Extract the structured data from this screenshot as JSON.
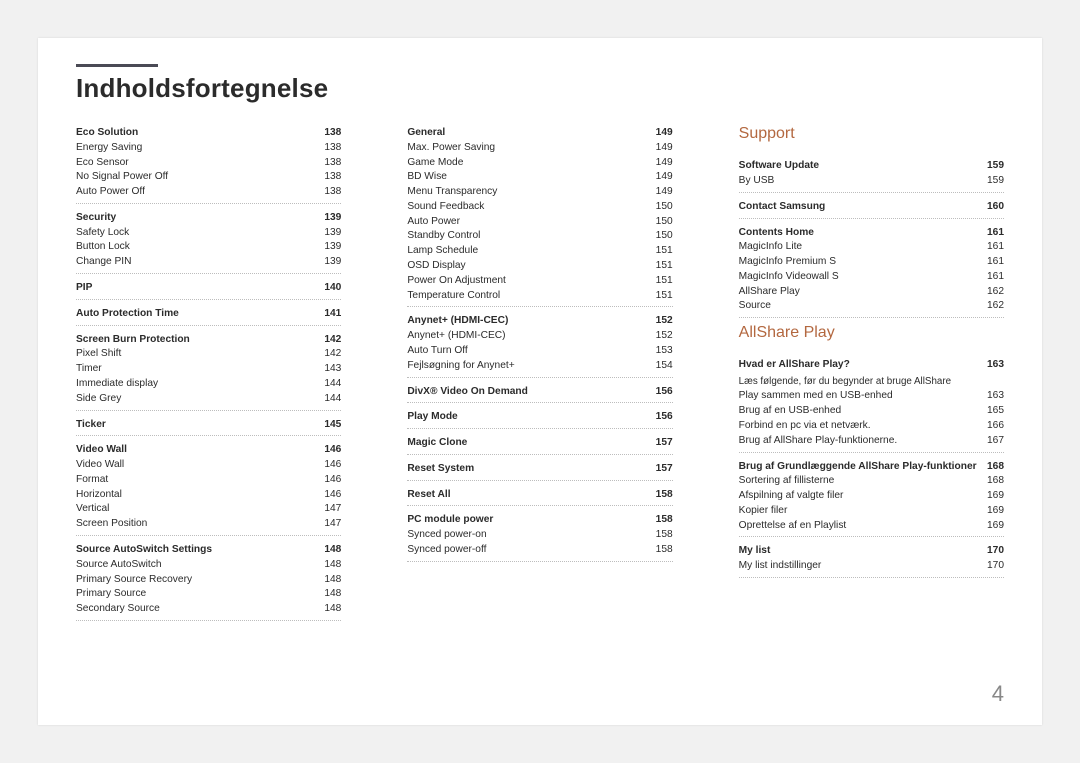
{
  "title": "Indholdsfortegnelse",
  "page_number": "4",
  "col1": [
    {
      "title": "Eco Solution",
      "page": "138",
      "items": [
        {
          "label": "Energy Saving",
          "page": "138"
        },
        {
          "label": "Eco Sensor",
          "page": "138"
        },
        {
          "label": "No Signal Power Off",
          "page": "138"
        },
        {
          "label": "Auto Power Off",
          "page": "138"
        }
      ]
    },
    {
      "title": "Security",
      "page": "139",
      "items": [
        {
          "label": "Safety Lock",
          "page": "139"
        },
        {
          "label": "Button Lock",
          "page": "139"
        },
        {
          "label": "Change PIN",
          "page": "139"
        }
      ]
    },
    {
      "title": "PIP",
      "page": "140",
      "items": []
    },
    {
      "title": "Auto Protection Time",
      "page": "141",
      "items": []
    },
    {
      "title": "Screen Burn Protection",
      "page": "142",
      "items": [
        {
          "label": "Pixel Shift",
          "page": "142"
        },
        {
          "label": "Timer",
          "page": "143"
        },
        {
          "label": "Immediate display",
          "page": "144"
        },
        {
          "label": "Side Grey",
          "page": "144"
        }
      ]
    },
    {
      "title": "Ticker",
      "page": "145",
      "items": []
    },
    {
      "title": "Video Wall",
      "page": "146",
      "items": [
        {
          "label": "Video Wall",
          "page": "146"
        },
        {
          "label": "Format",
          "page": "146"
        },
        {
          "label": "Horizontal",
          "page": "146"
        },
        {
          "label": "Vertical",
          "page": "147"
        },
        {
          "label": "Screen Position",
          "page": "147"
        }
      ]
    },
    {
      "title": "Source AutoSwitch Settings",
      "page": "148",
      "items": [
        {
          "label": "Source AutoSwitch",
          "page": "148"
        },
        {
          "label": "Primary Source Recovery",
          "page": "148"
        },
        {
          "label": "Primary Source",
          "page": "148"
        },
        {
          "label": "Secondary Source",
          "page": "148"
        }
      ]
    }
  ],
  "col2": [
    {
      "title": "General",
      "page": "149",
      "items": [
        {
          "label": "Max. Power Saving",
          "page": "149"
        },
        {
          "label": "Game Mode",
          "page": "149"
        },
        {
          "label": "BD Wise",
          "page": "149"
        },
        {
          "label": "Menu Transparency",
          "page": "149"
        },
        {
          "label": "Sound Feedback",
          "page": "150"
        },
        {
          "label": "Auto Power",
          "page": "150"
        },
        {
          "label": "Standby Control",
          "page": "150"
        },
        {
          "label": "Lamp Schedule",
          "page": "151"
        },
        {
          "label": "OSD Display",
          "page": "151"
        },
        {
          "label": "Power On Adjustment",
          "page": "151"
        },
        {
          "label": "Temperature Control",
          "page": "151"
        }
      ]
    },
    {
      "title": "Anynet+ (HDMI-CEC)",
      "page": "152",
      "items": [
        {
          "label": "Anynet+ (HDMI-CEC)",
          "page": "152"
        },
        {
          "label": "Auto Turn Off",
          "page": "153"
        },
        {
          "label": "Fejlsøgning for Anynet+",
          "page": "154"
        }
      ]
    },
    {
      "title": "DivX® Video On Demand",
      "page": "156",
      "items": []
    },
    {
      "title": "Play Mode",
      "page": "156",
      "items": []
    },
    {
      "title": "Magic Clone",
      "page": "157",
      "items": []
    },
    {
      "title": "Reset System",
      "page": "157",
      "items": []
    },
    {
      "title": "Reset All",
      "page": "158",
      "items": []
    },
    {
      "title": "PC module power",
      "page": "158",
      "items": [
        {
          "label": "Synced power-on",
          "page": "158"
        },
        {
          "label": "Synced power-off",
          "page": "158"
        }
      ]
    }
  ],
  "col3": [
    {
      "chapter": "Support"
    },
    {
      "title": "Software Update",
      "page": "159",
      "items": [
        {
          "label": "By USB",
          "page": "159"
        }
      ]
    },
    {
      "title": "Contact Samsung",
      "page": "160",
      "items": []
    },
    {
      "title": "Contents Home",
      "page": "161",
      "items": [
        {
          "label": "MagicInfo Lite",
          "page": "161"
        },
        {
          "label": "MagicInfo Premium S",
          "page": "161"
        },
        {
          "label": "MagicInfo Videowall S",
          "page": "161"
        },
        {
          "label": "AllShare Play",
          "page": "162"
        },
        {
          "label": "Source",
          "page": "162"
        }
      ]
    },
    {
      "chapter": "AllShare Play"
    },
    {
      "title": "Hvad er AllShare Play?",
      "page": "163",
      "extra": "Læs følgende, før du begynder at bruge AllShare",
      "items": [
        {
          "label": "Play sammen med en USB-enhed",
          "page": "163"
        },
        {
          "label": "Brug af en USB-enhed",
          "page": "165"
        },
        {
          "label": "Forbind en pc via et netværk.",
          "page": "166"
        },
        {
          "label": "Brug af AllShare Play-funktionerne.",
          "page": "167"
        }
      ]
    },
    {
      "title": "Brug af Grundlæggende AllShare Play-funktioner",
      "page": "168",
      "items": [
        {
          "label": "Sortering af fillisterne",
          "page": "168"
        },
        {
          "label": "Afspilning af valgte filer",
          "page": "169"
        },
        {
          "label": "Kopier filer",
          "page": "169"
        },
        {
          "label": "Oprettelse af en Playlist",
          "page": "169"
        }
      ]
    },
    {
      "title": "My list",
      "page": "170",
      "items": [
        {
          "label": "My list indstillinger",
          "page": "170"
        }
      ]
    }
  ]
}
